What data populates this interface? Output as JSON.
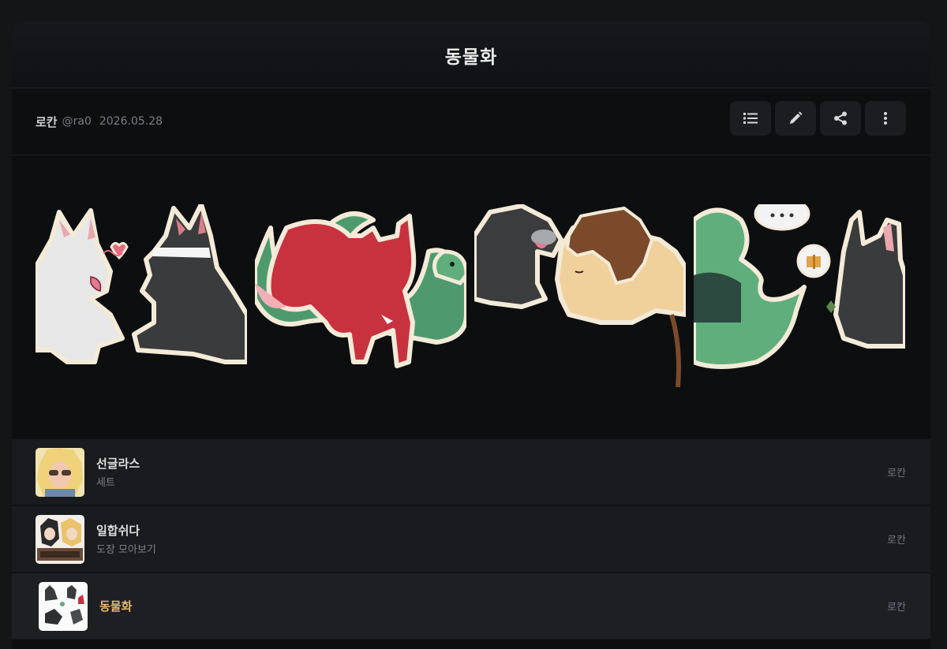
{
  "post": {
    "title": "동물화",
    "author": "로칸",
    "handle": "@ra0",
    "date": "2026.05.28"
  },
  "toolbar": {
    "icons": [
      "list-icon",
      "pencil-icon",
      "share-icon",
      "more-vertical-icon"
    ]
  },
  "list": {
    "items": [
      {
        "title": "선글라스",
        "subtitle": "세트",
        "author": "로칸",
        "active": false
      },
      {
        "title": "일합쉬다",
        "subtitle": "도장 모아보기",
        "author": "로칸",
        "active": false
      },
      {
        "title": "동물화",
        "subtitle": "",
        "author": "로칸",
        "active": true
      }
    ]
  },
  "colors": {
    "background": "#141516",
    "card": "#0d0e10",
    "accent_title": "#e8b86a",
    "heart": "#e56b80",
    "snake_green": "#4e9a6e",
    "red_fox": "#c8323f",
    "lion_mane": "#7a4a2a"
  }
}
